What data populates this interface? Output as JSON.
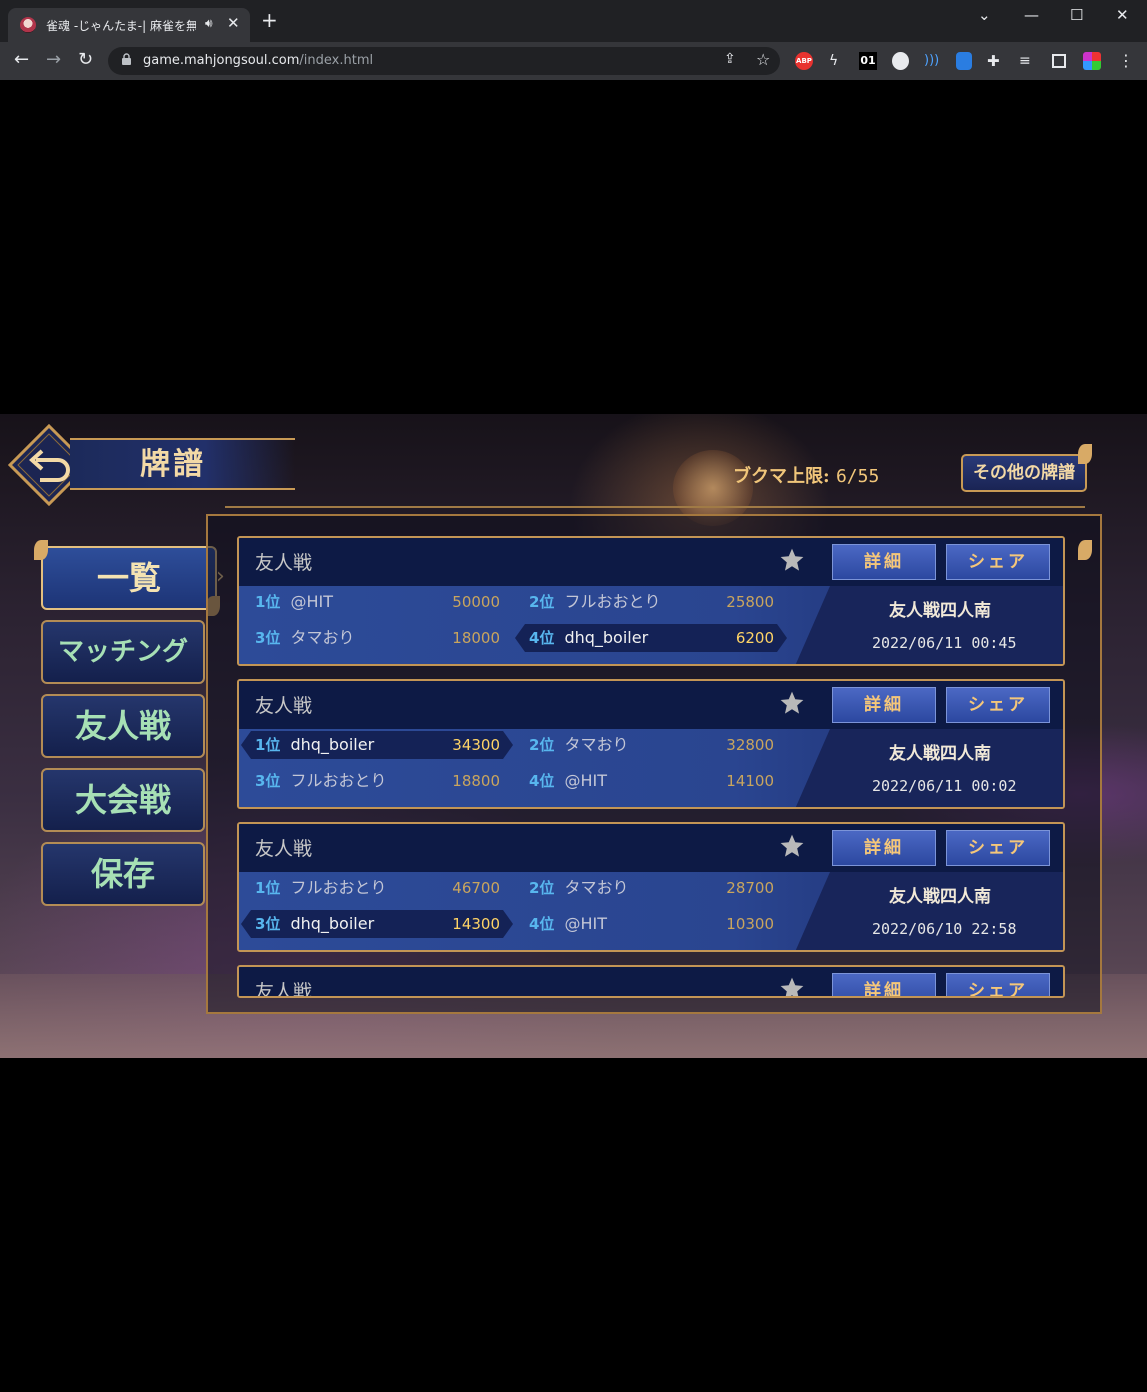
{
  "browser": {
    "tab_title": "雀魂 -じゃんたま-| 麻雀を無料で",
    "url_domain": "game.mahjongsoul.com",
    "url_path": "/index.html",
    "extensions": [
      "ABP",
      "01"
    ]
  },
  "page": {
    "title": "牌譜",
    "bookmark_label": "ブクマ上限:",
    "bookmark_value": "6/55",
    "other_button": "その他の牌譜"
  },
  "sidebar": {
    "items": [
      {
        "label": "一覧",
        "active": true
      },
      {
        "label": "マッチング",
        "active": false
      },
      {
        "label": "友人戦",
        "active": false
      },
      {
        "label": "大会戦",
        "active": false
      },
      {
        "label": "保存",
        "active": false
      }
    ]
  },
  "records": [
    {
      "title": "友人戦",
      "detail_label": "詳細",
      "share_label": "シェア",
      "mode": "友人戦四人南",
      "datetime": "2022/06/11 00:45",
      "players": [
        {
          "rank": "1位",
          "name": "@HIT",
          "score": "50000"
        },
        {
          "rank": "2位",
          "name": "フルおおとり",
          "score": "25800"
        },
        {
          "rank": "3位",
          "name": "タマおり",
          "score": "18000"
        },
        {
          "rank": "4位",
          "name": "dhq_boiler",
          "score": "6200"
        }
      ],
      "highlight": 3
    },
    {
      "title": "友人戦",
      "detail_label": "詳細",
      "share_label": "シェア",
      "mode": "友人戦四人南",
      "datetime": "2022/06/11 00:02",
      "players": [
        {
          "rank": "1位",
          "name": "dhq_boiler",
          "score": "34300"
        },
        {
          "rank": "2位",
          "name": "タマおり",
          "score": "32800"
        },
        {
          "rank": "3位",
          "name": "フルおおとり",
          "score": "18800"
        },
        {
          "rank": "4位",
          "name": "@HIT",
          "score": "14100"
        }
      ],
      "highlight": 0
    },
    {
      "title": "友人戦",
      "detail_label": "詳細",
      "share_label": "シェア",
      "mode": "友人戦四人南",
      "datetime": "2022/06/10 22:58",
      "players": [
        {
          "rank": "1位",
          "name": "フルおおとり",
          "score": "46700"
        },
        {
          "rank": "2位",
          "name": "タマおり",
          "score": "28700"
        },
        {
          "rank": "3位",
          "name": "dhq_boiler",
          "score": "14300"
        },
        {
          "rank": "4位",
          "name": "@HIT",
          "score": "10300"
        }
      ],
      "highlight": 2
    },
    {
      "title": "友人戦",
      "detail_label": "詳細",
      "share_label": "シェア"
    }
  ],
  "colors": {
    "accent_gold": "#c89a55",
    "rank_blue": "#58b6ee",
    "score_gold": "#c9a55e",
    "highlight_score": "#ffd466"
  }
}
